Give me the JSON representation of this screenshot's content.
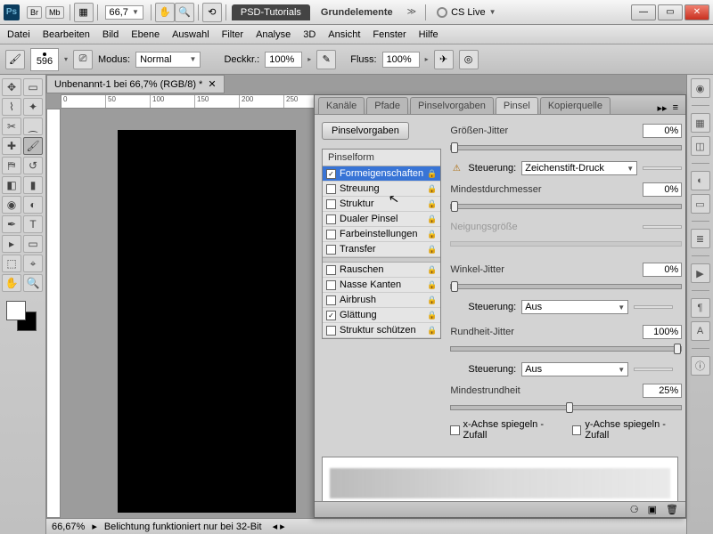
{
  "title": {
    "zoom": "66,7",
    "app_ps": "Ps",
    "br": "Br",
    "mb": "Mb",
    "appTab1": "PSD-Tutorials",
    "appTab2": "Grundelemente",
    "cslive": "CS Live"
  },
  "menu": [
    "Datei",
    "Bearbeiten",
    "Bild",
    "Ebene",
    "Auswahl",
    "Filter",
    "Analyse",
    "3D",
    "Ansicht",
    "Fenster",
    "Hilfe"
  ],
  "opt": {
    "size": "596",
    "modus_lbl": "Modus:",
    "modus_val": "Normal",
    "deck_lbl": "Deckkr.:",
    "deck_val": "100%",
    "fluss_lbl": "Fluss:",
    "fluss_val": "100%"
  },
  "doc": {
    "tab": "Unbenannt-1 bei 66,7% (RGB/8) *",
    "status_zoom": "66,67%",
    "status_msg": "Belichtung funktioniert nur bei 32-Bit"
  },
  "ptabs": [
    "Kanäle",
    "Pfade",
    "Pinselvorgaben",
    "Pinsel",
    "Kopierquelle"
  ],
  "presets_btn": "Pinselvorgaben",
  "bl_head": "Pinselform",
  "bl": [
    {
      "label": "Formeigenschaften",
      "chk": true,
      "sel": true
    },
    {
      "label": "Streuung",
      "chk": false
    },
    {
      "label": "Struktur",
      "chk": false
    },
    {
      "label": "Dualer Pinsel",
      "chk": false
    },
    {
      "label": "Farbeinstellungen",
      "chk": false
    },
    {
      "label": "Transfer",
      "chk": false
    }
  ],
  "bl2": [
    {
      "label": "Rauschen",
      "chk": false
    },
    {
      "label": "Nasse Kanten",
      "chk": false
    },
    {
      "label": "Airbrush",
      "chk": false
    },
    {
      "label": "Glättung",
      "chk": true
    },
    {
      "label": "Struktur schützen",
      "chk": false
    }
  ],
  "r": {
    "size_jitter": "Größen-Jitter",
    "size_jitter_v": "0%",
    "steuer": "Steuerung:",
    "steuer1": "Zeichenstift-Druck",
    "mindest": "Mindestdurchmesser",
    "mindest_v": "0%",
    "neig": "Neigungsgröße",
    "winkel": "Winkel-Jitter",
    "winkel_v": "0%",
    "steuer2": "Aus",
    "rund": "Rundheit-Jitter",
    "rund_v": "100%",
    "steuer3": "Aus",
    "minrund": "Mindestrundheit",
    "minrund_v": "25%",
    "flipx": "x-Achse spiegeln - Zufall",
    "flipy": "y-Achse spiegeln - Zufall"
  }
}
